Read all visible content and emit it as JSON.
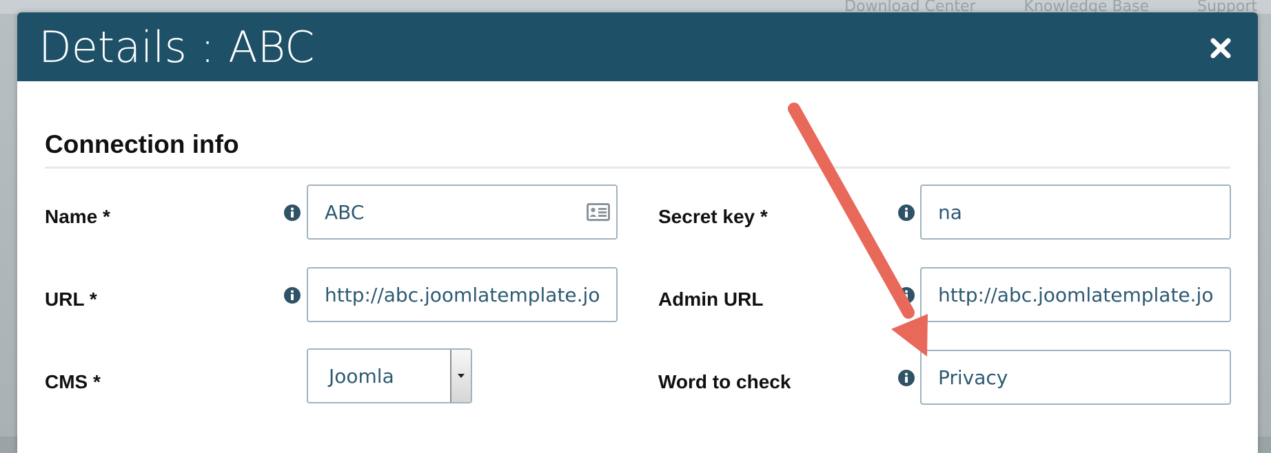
{
  "background": {
    "topnav": [
      "Download Center",
      "Knowledge Base",
      "Support"
    ]
  },
  "modal": {
    "title": "Details : ABC",
    "close_icon": "close-icon",
    "header_color": "#1e5068"
  },
  "section": {
    "title": "Connection info"
  },
  "fields": {
    "name": {
      "label": "Name *",
      "value": "ABC",
      "icon": "contact-card-icon"
    },
    "secret_key": {
      "label": "Secret key *",
      "value": "na"
    },
    "url": {
      "label": "URL *",
      "value": "http://abc.joomlatemplate.joomla.com"
    },
    "admin_url": {
      "label": "Admin URL",
      "value": "http://abc.joomlatemplate.joomla.com/administrator"
    },
    "cms": {
      "label": "CMS *",
      "value": "Joomla"
    },
    "word_to_check": {
      "label": "Word to check",
      "value": "Privacy"
    }
  },
  "annotation": {
    "arrow_color": "#e8685a"
  }
}
